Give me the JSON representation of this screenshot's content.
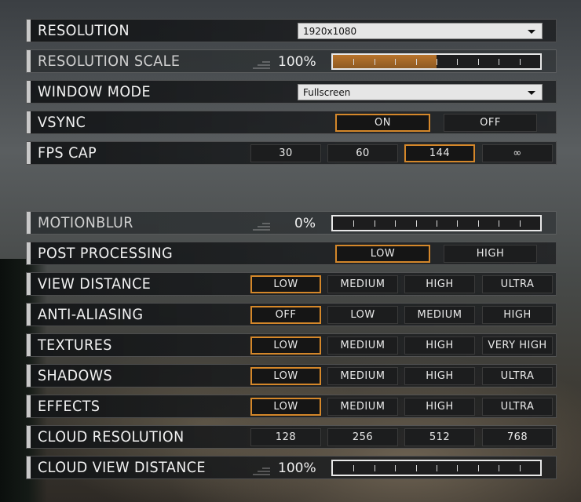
{
  "accent": "#d4872a",
  "resolution": {
    "label": "RESOLUTION",
    "value": "1920x1080"
  },
  "resolution_scale": {
    "label": "RESOLUTION SCALE",
    "value": "100%",
    "fill": 0.5
  },
  "window_mode": {
    "label": "WINDOW MODE",
    "value": "Fullscreen"
  },
  "vsync": {
    "label": "VSYNC",
    "options": [
      "ON",
      "OFF"
    ],
    "selected": 0
  },
  "fps_cap": {
    "label": "FPS CAP",
    "options": [
      "30",
      "60",
      "144",
      "∞"
    ],
    "selected": 2
  },
  "motion_blur": {
    "label": "MOTIONBLUR",
    "value": "0%",
    "fill": 0
  },
  "post_processing": {
    "label": "POST PROCESSING",
    "options": [
      "LOW",
      "HIGH"
    ],
    "selected": 0
  },
  "view_distance": {
    "label": "VIEW DISTANCE",
    "options": [
      "LOW",
      "MEDIUM",
      "HIGH",
      "ULTRA"
    ],
    "selected": 0
  },
  "anti_aliasing": {
    "label": "ANTI-ALIASING",
    "options": [
      "OFF",
      "LOW",
      "MEDIUM",
      "HIGH"
    ],
    "selected": 0
  },
  "textures": {
    "label": "TEXTURES",
    "options": [
      "LOW",
      "MEDIUM",
      "HIGH",
      "VERY HIGH"
    ],
    "selected": 0
  },
  "shadows": {
    "label": "SHADOWS",
    "options": [
      "LOW",
      "MEDIUM",
      "HIGH",
      "ULTRA"
    ],
    "selected": 0
  },
  "effects": {
    "label": "EFFECTS",
    "options": [
      "LOW",
      "MEDIUM",
      "HIGH",
      "ULTRA"
    ],
    "selected": 0
  },
  "cloud_resolution": {
    "label": "CLOUD RESOLUTION",
    "options": [
      "128",
      "256",
      "512",
      "768"
    ],
    "selected": -1
  },
  "cloud_view_distance": {
    "label": "CLOUD VIEW DISTANCE",
    "value": "100%",
    "fill": 0
  }
}
